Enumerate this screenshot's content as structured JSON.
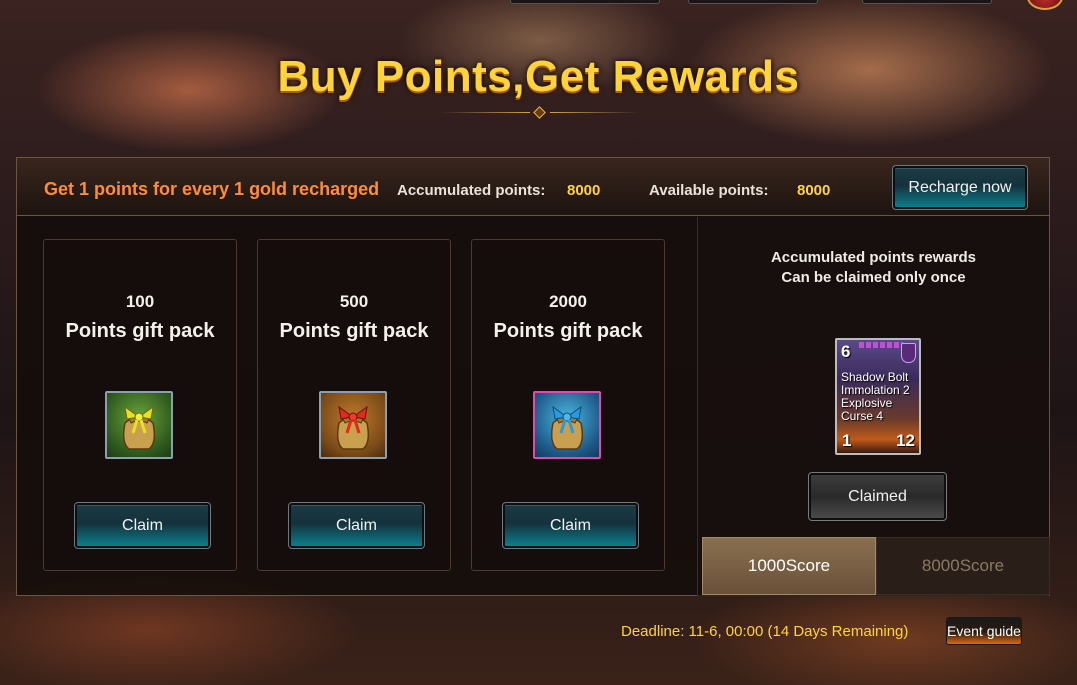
{
  "header": {
    "title": "Buy Points,Get Rewards"
  },
  "info_bar": {
    "rule_text": "Get 1 points for every 1 gold recharged",
    "accumulated_label": "Accumulated points:",
    "accumulated_value": "8000",
    "available_label": "Available points:",
    "available_value": "8000",
    "recharge_label": "Recharge now"
  },
  "packs": [
    {
      "amount": "100",
      "name": "Points gift pack",
      "icon": "green-ribbon-gift-bag-icon",
      "claim_label": "Claim"
    },
    {
      "amount": "500",
      "name": "Points gift pack",
      "icon": "red-ribbon-gift-bag-icon",
      "claim_label": "Claim"
    },
    {
      "amount": "2000",
      "name": "Points gift pack",
      "icon": "blue-ribbon-gift-bag-icon",
      "claim_label": "Claim"
    }
  ],
  "rewards": {
    "description_line1": "Accumulated points rewards",
    "description_line2": "Can be claimed only once",
    "card": {
      "cost": "6",
      "ability_lines": [
        "Shadow Bolt",
        "Immolation 2",
        "Explosive",
        "Curse 4"
      ],
      "attack": "1",
      "health": "12"
    },
    "claimed_label": "Claimed",
    "tabs": [
      {
        "label": "1000Score",
        "active": true
      },
      {
        "label": "8000Score",
        "active": false
      }
    ]
  },
  "footer": {
    "deadline": "Deadline: 11-6, 00:00 (14 Days Remaining)",
    "guide_label": "Event guide"
  },
  "colors": {
    "title": "#ffd43a",
    "rule_text": "#ff8c3a",
    "value": "#ffd43a",
    "button_teal": "#0c7e8c"
  }
}
